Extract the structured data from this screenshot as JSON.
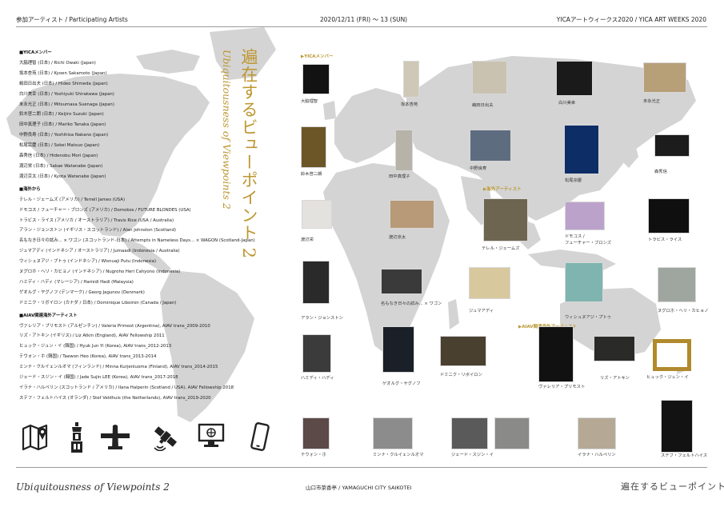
{
  "header": {
    "left": "参加アーティスト / Participating Artists",
    "center": "2020/12/11 (FRI) 〜 13 (SUN)",
    "right": "YICAアートウィークス2020 / YICA ART WEEKS 2020"
  },
  "title": {
    "jp": "遍在するビューポイント 2",
    "en": "Ubiquitousness of Viewpoints 2"
  },
  "sections": [
    {
      "heading": "■YICAメンバー",
      "items": [
        "大脇理智 (日本) / Richi Owaki (Japan)",
        "坂本杏苑 (日本) / Kyoen Sakamoto (Japan)",
        "嶋田日出夫 (日本) / Hideo Shimeda (Japan)",
        "白川美幸 (日本) / Yoshiyuki Shirakawa (Japan)",
        "末永光正 (日本) / Mitsumasa Suenaga (Japan)",
        "鈴木啓二朗 (日本) / Keijiro Suzuki (Japan)",
        "田中真理子 (日本) / Mariko Tanaka (Japan)",
        "中野良寿 (日本) / Yoshihisa Nakano (Japan)",
        "松尾宗慶 (日本) / Sokei Matsuo (Japan)",
        "森秀信 (日本) / Hidenobu Mori (Japan)",
        "渡辺栄 (日本) / Sakae Watanabe (Japan)",
        "渡辺京太 (日本) / Kyota Watanabe (Japan)"
      ]
    },
    {
      "heading": "■海外から",
      "items": [
        "テレル・ジェームズ (アメリカ) / Terrell James (USA)",
        "ドモコス / フューチャー・ブロンズ (アメリカ) / Domokos / FUTURE BLONDES (USA)",
        "トラビス・ライス (アメリカ / オーストラリア) / Travis Rice (USA / Australia)",
        "アラン・ジョンストン (イギリス・スコットランド) / Alan Johnston (Scotland)",
        "名もなき日々の試み... × ワゴン (スコットランド-日本) / Attempts in Nameless Days... × WAGON (Scotland-Japan)",
        "ジュマアディ (インドネシア / オーストラリア) / Jumaadi (Indonesia / Australia)",
        "ウィシュヌアジ・プトゥ (インドネシア) / Wisnuaji Putu (Indonesia)",
        "ヌグロホ・ヘリ・カヒョノ (インドネシア) / Nugroho Heri Cahyono (Indonesia)",
        "ハミディ・ハディ (マレーシア) / Hamidi Hadi (Malaysia)",
        "ゲオルグ・ヤグノフ (デンマーク) / Georg Jagunov (Denmark)",
        "ドミニク・リボイロン (カナダ / 日本) / Dominique Liboiron (Canada / Japan)"
      ]
    },
    {
      "heading": "■AIAV関連海外アーティスト",
      "items": [
        "ヴァレリア・プリモスト (アルゼンチン) / Valeria Primost (Argentina), AIAV trans_2009-2010",
        "リズ・アトキン (イギリス) / Liz Atkin (England), AIAV Fellowship 2011",
        "ヒュック・ジュン・イ (韓国) / Hyuk Jun Yi (Korea), AIAV trans_2012-2013",
        "テウォン・ホ (韓国) / Taewon Heo (Korea), AIAV trans_2013-2014",
        "ミンナ・クルイェンルオマ (フィンランド) / Minna Kurjenluoma (Finland), AIAV trans_2014-2015",
        "ジェード・スジン・イ (韓国) / Jade Sujin LEE (Korea), AIAV trans_2017-2018",
        "イラナ・ハルペリン (スコットランド / アメリカ) / Ilana Halperin (Scotland / USA), AIAV Fellowship 2018",
        "ステフ・フェルトハイス (オランダ) / Stef Veldhuis (the Netherlands), AIAV trans_2019-2020"
      ]
    }
  ],
  "labels": {
    "yica": "▶YICAメンバー",
    "overseas": "▶海外アーティスト",
    "aiav": "▶AIAV関連海外アーティスト"
  },
  "thumbs": [
    {
      "caption": "大脇理智",
      "bg": "#121212"
    },
    {
      "caption": "坂本杏苑",
      "bg": "#cfc8b6"
    },
    {
      "caption": "嶋田日出夫",
      "bg": "#c9c2b0"
    },
    {
      "caption": "白川美幸",
      "bg": "#1a1a1a"
    },
    {
      "caption": "末永光正",
      "bg": "#b79f78"
    },
    {
      "caption": "鈴木啓二朗",
      "bg": "#6c5628"
    },
    {
      "caption": "田中真理子",
      "bg": "#b7b3a8"
    },
    {
      "caption": "中野良寿",
      "bg": "#5e6c80"
    },
    {
      "caption": "松尾宗慶",
      "bg": "#0d2d66"
    },
    {
      "caption": "森秀信",
      "bg": "#1c1c1c"
    },
    {
      "caption": "渡辺栄",
      "bg": "#e4e2de"
    },
    {
      "caption": "渡辺京太",
      "bg": "#b89a79"
    },
    {
      "caption": "テレル・ジェームズ",
      "bg": "#6e6550"
    },
    {
      "caption": "ドモコス /\nフューチャー・ブロンズ",
      "bg": "#bba2cb"
    },
    {
      "caption": "トラビス・ライス",
      "bg": "#0f0f0f"
    },
    {
      "caption": "アラン・ジョンストン",
      "bg": "#2a2a2a"
    },
    {
      "caption": "名もなき日々の試み... × ワゴン",
      "bg": "#3a3a3a"
    },
    {
      "caption": "ジュマアディ",
      "bg": "#d7c89e"
    },
    {
      "caption": "ウィシュヌアジ・プトゥ",
      "bg": "#7fb4b0"
    },
    {
      "caption": "ヌグロホ・ヘリ・カヒョノ",
      "bg": "#9fa6a0"
    },
    {
      "caption": "ハミディ・ハディ",
      "bg": "#3b3b3b"
    },
    {
      "caption": "ゲオルグ・ヤグノフ",
      "bg": "#1a1f28"
    },
    {
      "caption": "ドミニク・リボイロン",
      "bg": "#4a4030"
    },
    {
      "caption": "ヴァレリア・プリモスト",
      "bg": "#111111"
    },
    {
      "caption": "リズ・アトキン",
      "bg": "#2a2a28"
    },
    {
      "caption": "ヒュック・ジュン・イ",
      "bg": "#5c4a1e"
    },
    {
      "caption": "テウォン・ホ",
      "bg": "#5b4a48"
    },
    {
      "caption": "ミンナ・クルイェンルオマ",
      "bg": "#8c8c8c"
    },
    {
      "caption": "ジェード・スジン・イ",
      "bg": "#5a5a5a"
    },
    {
      "caption": "",
      "bg": "#8a8a88"
    },
    {
      "caption": "イラナ・ハルペリン",
      "bg": "#b5a996"
    },
    {
      "caption": "ステフ・フェルトハイス",
      "bg": "#121212"
    }
  ],
  "icons": [
    "map-icon",
    "tower-icon",
    "airplane-icon",
    "satellite-icon",
    "computer-icon",
    "smartphone-icon"
  ],
  "footer": {
    "left": "Ubiquitousness of Viewpoints 2",
    "center": "山口市菜香亭 / YAMAGUCHI CITY SAIKOTEI",
    "right": "遍在するビューポイント 2"
  },
  "colors": {
    "accent": "#bd9730",
    "map": "#d4d4d4"
  }
}
